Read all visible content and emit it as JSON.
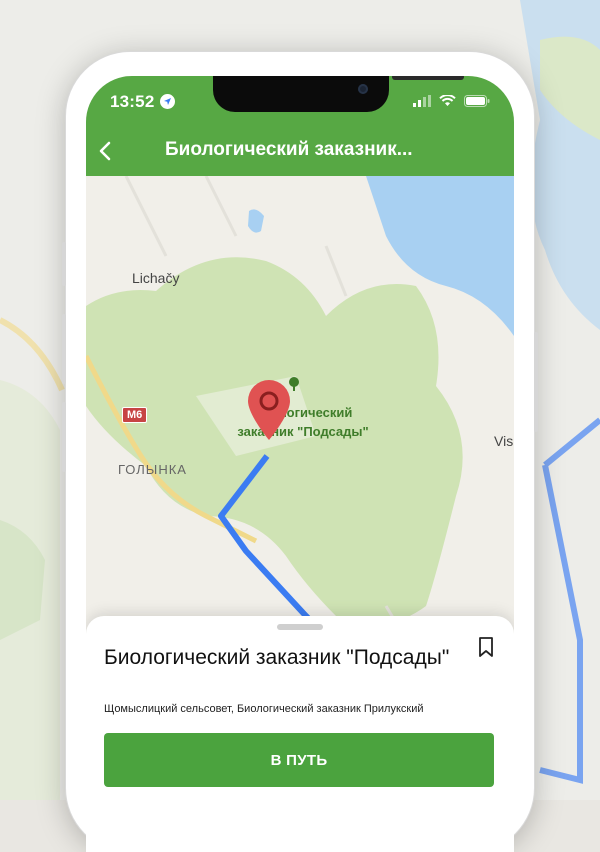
{
  "status_bar": {
    "time": "13:52",
    "icons": [
      "location-arrow-icon",
      "cellular-signal-icon",
      "wifi-icon",
      "battery-icon"
    ]
  },
  "header": {
    "title": "Биологический заказник...",
    "back_icon": "chevron-left-icon",
    "color": "#57a844"
  },
  "map": {
    "labels": {
      "village": "Lichačy",
      "town": "ГОЛЫНКА",
      "edge": "Vis",
      "road_badge": "M6"
    },
    "reserve_label": [
      "Биологический",
      "заказник \"Подсады\""
    ],
    "pin_color": "#e05252",
    "route_color": "#3b7cf2",
    "reserve_color": "#cfe3b4",
    "water_color": "#a8d0f2"
  },
  "sheet": {
    "place_name": "Биологический заказник \"Подсады\"",
    "address": "Щомыслицкий сельсовет, Биологический заказник Прилукский",
    "route_button": "В ПУТЬ",
    "bookmark_icon": "bookmark-icon",
    "button_color": "#4ba33e"
  }
}
